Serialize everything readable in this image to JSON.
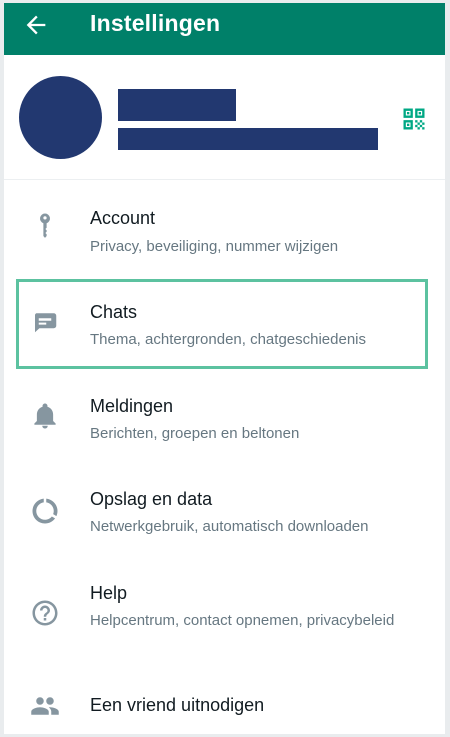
{
  "header": {
    "title": "Instellingen",
    "back_icon": "arrow-left-icon"
  },
  "profile": {
    "qr_icon": "qr-code-icon"
  },
  "settings": [
    {
      "icon": "key-icon",
      "title": "Account",
      "subtitle": "Privacy, beveiliging, nummer wijzigen"
    },
    {
      "icon": "chat-icon",
      "title": "Chats",
      "subtitle": "Thema, achtergronden, chatgeschiedenis"
    },
    {
      "icon": "bell-icon",
      "title": "Meldingen",
      "subtitle": "Berichten, groepen en beltonen"
    },
    {
      "icon": "data-usage-icon",
      "title": "Opslag en data",
      "subtitle": "Netwerkgebruik, automatisch downloaden"
    },
    {
      "icon": "help-icon",
      "title": "Help",
      "subtitle": "Helpcentrum, contact opnemen, privacybeleid"
    },
    {
      "icon": "people-icon",
      "title": "Een vriend uitnodigen",
      "subtitle": ""
    }
  ],
  "colors": {
    "accent": "#008069",
    "highlight": "#5cc2a0",
    "redaction": "#223870",
    "icon": "#8696a0"
  }
}
